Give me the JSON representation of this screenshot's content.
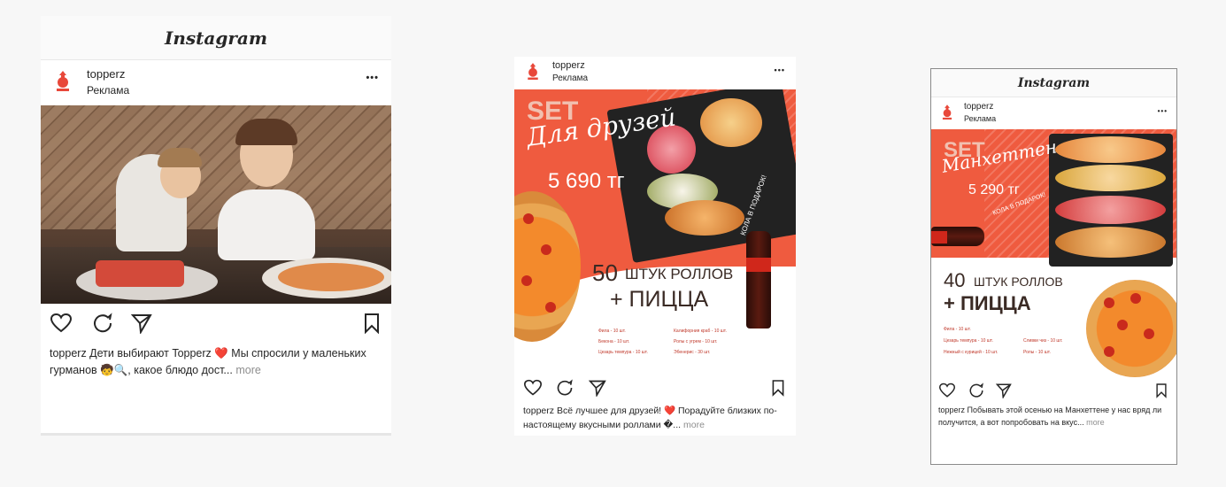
{
  "colors": {
    "brand": "#ef5b3f",
    "like": "#e8233d",
    "muted": "#8e8e8e"
  },
  "posts": [
    {
      "instagram_logo": "Instagram",
      "username": "topperz",
      "sponsored": "Реклама",
      "menu_icon": "•••",
      "caption_user": "topperz",
      "caption_text": " Дети выбирают Topperz ❤️ Мы спросили у маленьких гурманов 🧒🔍, какое блюдо дост...",
      "more": "more"
    },
    {
      "username": "topperz",
      "sponsored": "Реклама",
      "menu_icon": "•••",
      "ad": {
        "set": "SET",
        "title": "Для друзей",
        "price": "5 690 тг",
        "gift": "КОЛА В ПОДАРОК!",
        "count": "50",
        "count_text": "ШТУК РОЛЛОВ",
        "plus": "+ ПИЦЦА",
        "menu_left": [
          "Фила - 10 шт.",
          "Бекона - 10 шт.",
          "Цезарь темпура - 10 шт."
        ],
        "menu_right": [
          "Калифорния краб - 10 шт.",
          "Ролы с угрем - 10 шт.",
          "Эбенерис - 30 шт."
        ]
      },
      "caption_user": "topperz",
      "caption_text": " Всё лучшее для друзей! ❤️ Порадуйте близких по-настоящему вкусными роллами �...",
      "more": "more"
    },
    {
      "instagram_logo": "Instagram",
      "username": "topperz",
      "sponsored": "Реклама",
      "menu_icon": "•••",
      "ad": {
        "set": "SET",
        "title": "Манхеттен",
        "price": "5 290 тг",
        "gift": "КОЛА В ПОДАРОК!",
        "count": "40",
        "count_text": "ШТУК РОЛЛОВ",
        "plus": "+ ПИЦЦА",
        "menu_left": [
          "Фила - 10 шт.",
          "Цезарь темпура - 10 шт.",
          "Нежный с курицей - 10 шт."
        ],
        "menu_right": [
          "Сливки чиз - 10 шт.",
          "Ролы - 10 шт."
        ]
      },
      "caption_user": "topperz",
      "caption_text": " Побывать этой осенью на Манхеттене у нас вряд ли получится, а вот попробовать на вкус...",
      "more": "more"
    }
  ]
}
